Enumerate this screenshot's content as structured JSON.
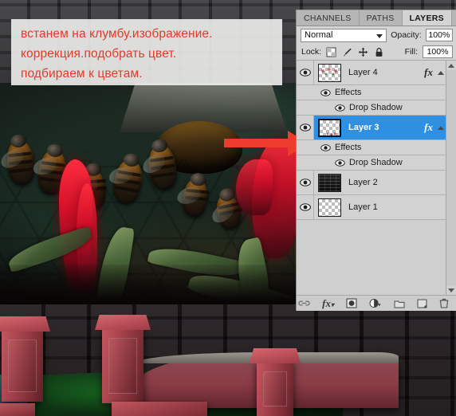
{
  "annotation": {
    "lines": [
      "встанем на клумбу.изображение.",
      "коррекция.подобрать цвет.",
      "подбираем к цветам."
    ],
    "text_color": "#e23b2a",
    "arrow_color": "#ee3c2c",
    "arrow_name": "red-pointer-arrow"
  },
  "panel": {
    "tabs": [
      {
        "label": "CHANNELS",
        "active": false
      },
      {
        "label": "PATHS",
        "active": false
      },
      {
        "label": "LAYERS",
        "active": true
      }
    ],
    "blend_mode": "Normal",
    "opacity_label": "Opacity:",
    "opacity_value": "100%",
    "lock_label": "Lock:",
    "lock_icons": [
      "transparency-lock-icon",
      "brush-lock-icon",
      "move-lock-icon",
      "all-lock-icon"
    ],
    "fill_label": "Fill:",
    "fill_value": "100%",
    "selected_color": "#2f8fe0",
    "rows": [
      {
        "type": "layer",
        "name": "Layer 4",
        "visible": true,
        "selected": false,
        "has_fx": true,
        "thumb": "flowers"
      },
      {
        "type": "effects",
        "name": "Effects",
        "visible": true
      },
      {
        "type": "effect",
        "name": "Drop Shadow",
        "visible": true
      },
      {
        "type": "layer",
        "name": "Layer 3",
        "visible": true,
        "selected": true,
        "has_fx": true,
        "thumb": "flowers2"
      },
      {
        "type": "effects",
        "name": "Effects",
        "visible": true
      },
      {
        "type": "effect",
        "name": "Drop Shadow",
        "visible": true
      },
      {
        "type": "layer",
        "name": "Layer 2",
        "visible": true,
        "selected": false,
        "has_fx": false,
        "thumb": "wall"
      },
      {
        "type": "layer",
        "name": "Layer 1",
        "visible": true,
        "selected": false,
        "has_fx": false,
        "thumb": "empty"
      }
    ],
    "bottom_tools": [
      "link-layers-icon",
      "layer-style-fx-icon",
      "layer-mask-icon",
      "adjustment-layer-icon",
      "new-group-folder-icon",
      "new-layer-icon",
      "delete-layer-trash-icon"
    ]
  }
}
